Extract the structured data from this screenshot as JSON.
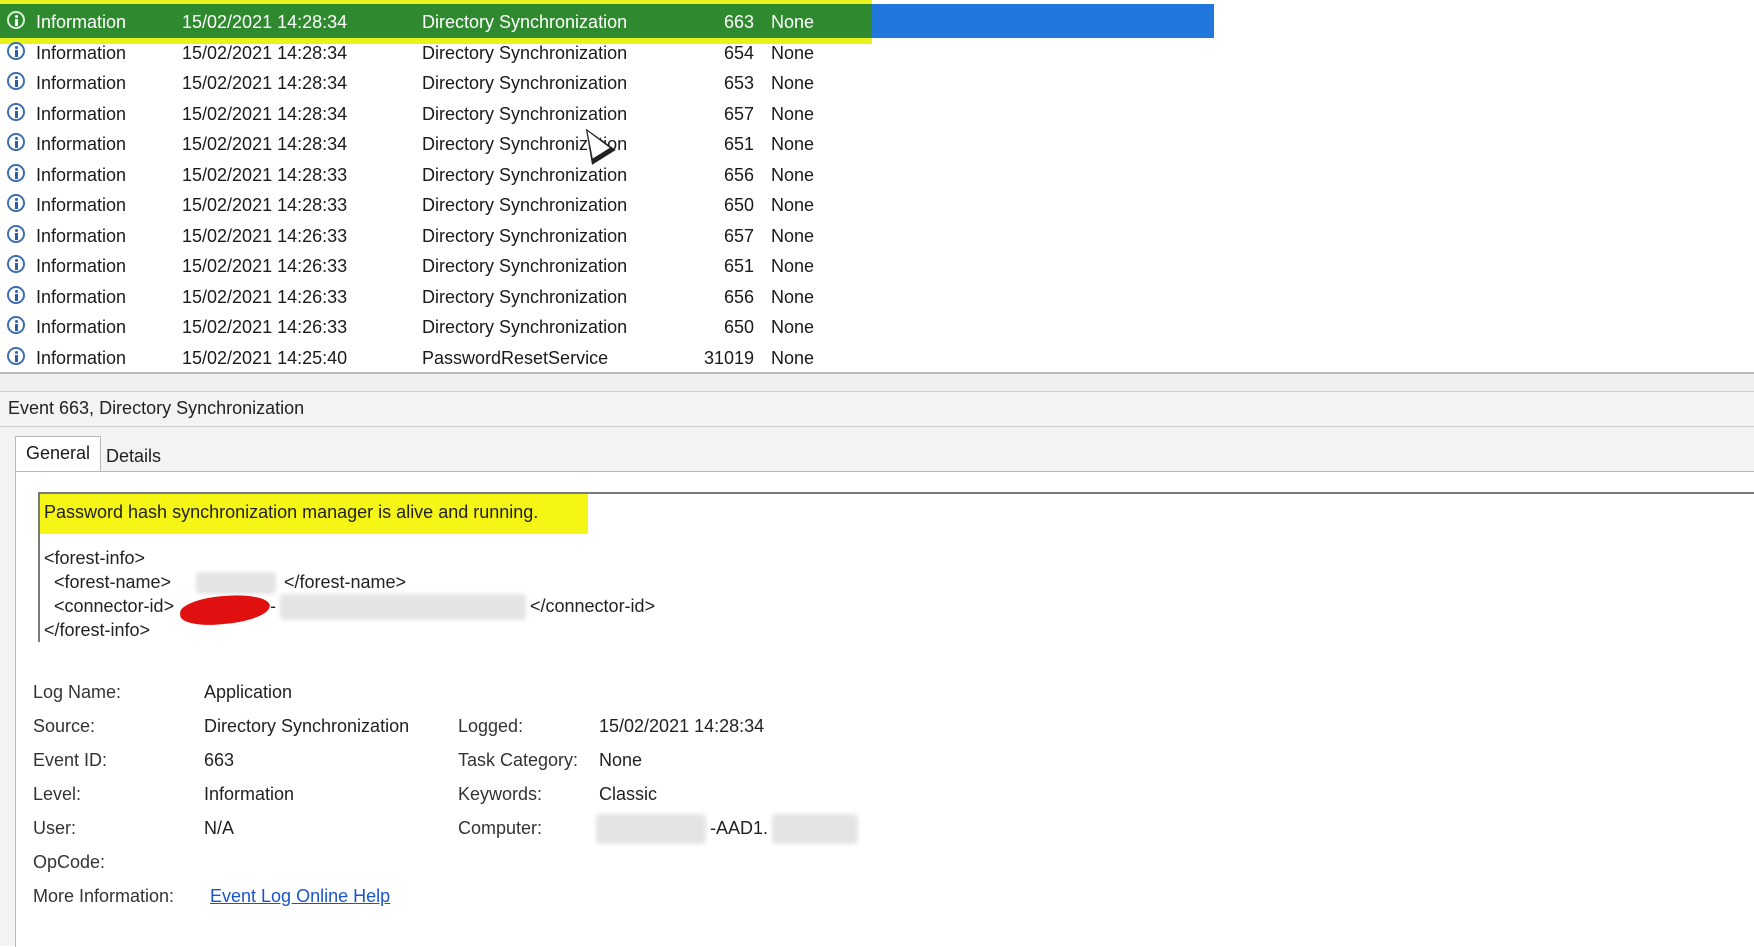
{
  "event_list": {
    "rows": [
      {
        "level": "Information",
        "date": "15/02/2021 14:28:34",
        "source": "Directory Synchronization",
        "event_id": "663",
        "task": "None",
        "selected": true
      },
      {
        "level": "Information",
        "date": "15/02/2021 14:28:34",
        "source": "Directory Synchronization",
        "event_id": "654",
        "task": "None"
      },
      {
        "level": "Information",
        "date": "15/02/2021 14:28:34",
        "source": "Directory Synchronization",
        "event_id": "653",
        "task": "None"
      },
      {
        "level": "Information",
        "date": "15/02/2021 14:28:34",
        "source": "Directory Synchronization",
        "event_id": "657",
        "task": "None"
      },
      {
        "level": "Information",
        "date": "15/02/2021 14:28:34",
        "source": "Directory Synchronization",
        "event_id": "651",
        "task": "None"
      },
      {
        "level": "Information",
        "date": "15/02/2021 14:28:33",
        "source": "Directory Synchronization",
        "event_id": "656",
        "task": "None"
      },
      {
        "level": "Information",
        "date": "15/02/2021 14:28:33",
        "source": "Directory Synchronization",
        "event_id": "650",
        "task": "None"
      },
      {
        "level": "Information",
        "date": "15/02/2021 14:26:33",
        "source": "Directory Synchronization",
        "event_id": "657",
        "task": "None"
      },
      {
        "level": "Information",
        "date": "15/02/2021 14:26:33",
        "source": "Directory Synchronization",
        "event_id": "651",
        "task": "None"
      },
      {
        "level": "Information",
        "date": "15/02/2021 14:26:33",
        "source": "Directory Synchronization",
        "event_id": "656",
        "task": "None"
      },
      {
        "level": "Information",
        "date": "15/02/2021 14:26:33",
        "source": "Directory Synchronization",
        "event_id": "650",
        "task": "None"
      },
      {
        "level": "Information",
        "date": "15/02/2021 14:25:40",
        "source": "PasswordResetService",
        "event_id": "31019",
        "task": "None"
      }
    ]
  },
  "details": {
    "title": "Event 663, Directory Synchronization",
    "tabs": {
      "general": "General",
      "details": "Details"
    },
    "description": "Password hash synchronization manager is alive and running.",
    "xml": {
      "forest_info_open": "<forest-info>",
      "forest_name_open": "<forest-name>",
      "forest_name_close": "</forest-name>",
      "connector_id_open": "<connector-id>",
      "connector_id_dash": "-",
      "connector_id_close": "</connector-id>",
      "forest_info_close": "</forest-info>"
    },
    "properties": {
      "log_name_label": "Log Name:",
      "log_name": "Application",
      "source_label": "Source:",
      "source": "Directory Synchronization",
      "logged_label": "Logged:",
      "logged": "15/02/2021 14:28:34",
      "event_id_label": "Event ID:",
      "event_id": "663",
      "task_category_label": "Task Category:",
      "task_category": "None",
      "level_label": "Level:",
      "level": "Information",
      "keywords_label": "Keywords:",
      "keywords": "Classic",
      "user_label": "User:",
      "user": "N/A",
      "computer_label": "Computer:",
      "computer_mid": "-AAD1.",
      "opcode_label": "OpCode:",
      "more_info_label": "More Information:",
      "more_info_link": "Event Log Online Help"
    }
  },
  "colors": {
    "selection_green": "#2f8a2f",
    "selection_blue": "#2277dd",
    "highlight_yellow": "#f5f516",
    "link": "#1a55c8"
  }
}
